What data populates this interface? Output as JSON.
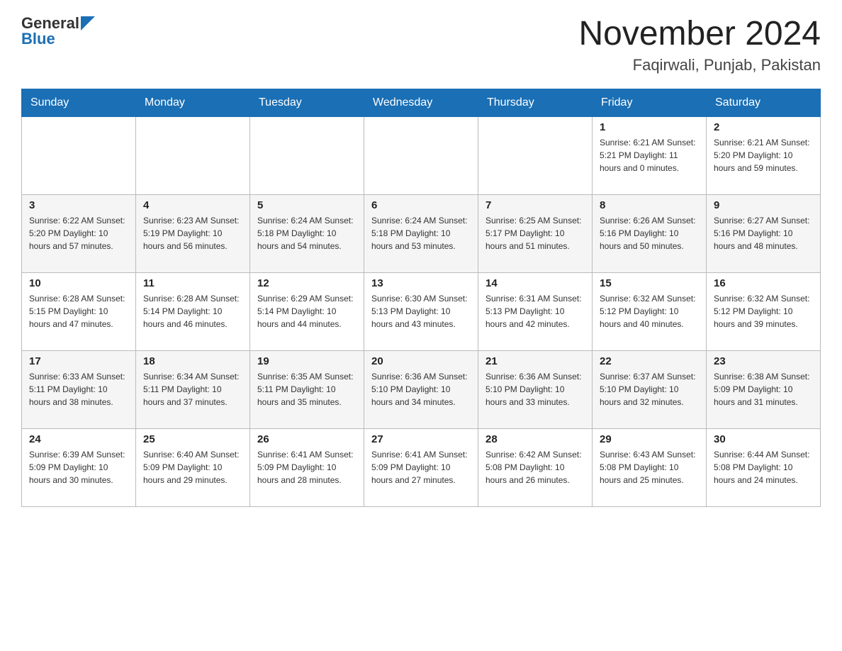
{
  "header": {
    "logo_text": "General",
    "logo_blue": "Blue",
    "month_year": "November 2024",
    "location": "Faqirwali, Punjab, Pakistan"
  },
  "days_of_week": [
    "Sunday",
    "Monday",
    "Tuesday",
    "Wednesday",
    "Thursday",
    "Friday",
    "Saturday"
  ],
  "weeks": [
    {
      "days": [
        {
          "num": "",
          "info": ""
        },
        {
          "num": "",
          "info": ""
        },
        {
          "num": "",
          "info": ""
        },
        {
          "num": "",
          "info": ""
        },
        {
          "num": "",
          "info": ""
        },
        {
          "num": "1",
          "info": "Sunrise: 6:21 AM\nSunset: 5:21 PM\nDaylight: 11 hours\nand 0 minutes."
        },
        {
          "num": "2",
          "info": "Sunrise: 6:21 AM\nSunset: 5:20 PM\nDaylight: 10 hours\nand 59 minutes."
        }
      ]
    },
    {
      "days": [
        {
          "num": "3",
          "info": "Sunrise: 6:22 AM\nSunset: 5:20 PM\nDaylight: 10 hours\nand 57 minutes."
        },
        {
          "num": "4",
          "info": "Sunrise: 6:23 AM\nSunset: 5:19 PM\nDaylight: 10 hours\nand 56 minutes."
        },
        {
          "num": "5",
          "info": "Sunrise: 6:24 AM\nSunset: 5:18 PM\nDaylight: 10 hours\nand 54 minutes."
        },
        {
          "num": "6",
          "info": "Sunrise: 6:24 AM\nSunset: 5:18 PM\nDaylight: 10 hours\nand 53 minutes."
        },
        {
          "num": "7",
          "info": "Sunrise: 6:25 AM\nSunset: 5:17 PM\nDaylight: 10 hours\nand 51 minutes."
        },
        {
          "num": "8",
          "info": "Sunrise: 6:26 AM\nSunset: 5:16 PM\nDaylight: 10 hours\nand 50 minutes."
        },
        {
          "num": "9",
          "info": "Sunrise: 6:27 AM\nSunset: 5:16 PM\nDaylight: 10 hours\nand 48 minutes."
        }
      ]
    },
    {
      "days": [
        {
          "num": "10",
          "info": "Sunrise: 6:28 AM\nSunset: 5:15 PM\nDaylight: 10 hours\nand 47 minutes."
        },
        {
          "num": "11",
          "info": "Sunrise: 6:28 AM\nSunset: 5:14 PM\nDaylight: 10 hours\nand 46 minutes."
        },
        {
          "num": "12",
          "info": "Sunrise: 6:29 AM\nSunset: 5:14 PM\nDaylight: 10 hours\nand 44 minutes."
        },
        {
          "num": "13",
          "info": "Sunrise: 6:30 AM\nSunset: 5:13 PM\nDaylight: 10 hours\nand 43 minutes."
        },
        {
          "num": "14",
          "info": "Sunrise: 6:31 AM\nSunset: 5:13 PM\nDaylight: 10 hours\nand 42 minutes."
        },
        {
          "num": "15",
          "info": "Sunrise: 6:32 AM\nSunset: 5:12 PM\nDaylight: 10 hours\nand 40 minutes."
        },
        {
          "num": "16",
          "info": "Sunrise: 6:32 AM\nSunset: 5:12 PM\nDaylight: 10 hours\nand 39 minutes."
        }
      ]
    },
    {
      "days": [
        {
          "num": "17",
          "info": "Sunrise: 6:33 AM\nSunset: 5:11 PM\nDaylight: 10 hours\nand 38 minutes."
        },
        {
          "num": "18",
          "info": "Sunrise: 6:34 AM\nSunset: 5:11 PM\nDaylight: 10 hours\nand 37 minutes."
        },
        {
          "num": "19",
          "info": "Sunrise: 6:35 AM\nSunset: 5:11 PM\nDaylight: 10 hours\nand 35 minutes."
        },
        {
          "num": "20",
          "info": "Sunrise: 6:36 AM\nSunset: 5:10 PM\nDaylight: 10 hours\nand 34 minutes."
        },
        {
          "num": "21",
          "info": "Sunrise: 6:36 AM\nSunset: 5:10 PM\nDaylight: 10 hours\nand 33 minutes."
        },
        {
          "num": "22",
          "info": "Sunrise: 6:37 AM\nSunset: 5:10 PM\nDaylight: 10 hours\nand 32 minutes."
        },
        {
          "num": "23",
          "info": "Sunrise: 6:38 AM\nSunset: 5:09 PM\nDaylight: 10 hours\nand 31 minutes."
        }
      ]
    },
    {
      "days": [
        {
          "num": "24",
          "info": "Sunrise: 6:39 AM\nSunset: 5:09 PM\nDaylight: 10 hours\nand 30 minutes."
        },
        {
          "num": "25",
          "info": "Sunrise: 6:40 AM\nSunset: 5:09 PM\nDaylight: 10 hours\nand 29 minutes."
        },
        {
          "num": "26",
          "info": "Sunrise: 6:41 AM\nSunset: 5:09 PM\nDaylight: 10 hours\nand 28 minutes."
        },
        {
          "num": "27",
          "info": "Sunrise: 6:41 AM\nSunset: 5:09 PM\nDaylight: 10 hours\nand 27 minutes."
        },
        {
          "num": "28",
          "info": "Sunrise: 6:42 AM\nSunset: 5:08 PM\nDaylight: 10 hours\nand 26 minutes."
        },
        {
          "num": "29",
          "info": "Sunrise: 6:43 AM\nSunset: 5:08 PM\nDaylight: 10 hours\nand 25 minutes."
        },
        {
          "num": "30",
          "info": "Sunrise: 6:44 AM\nSunset: 5:08 PM\nDaylight: 10 hours\nand 24 minutes."
        }
      ]
    }
  ]
}
